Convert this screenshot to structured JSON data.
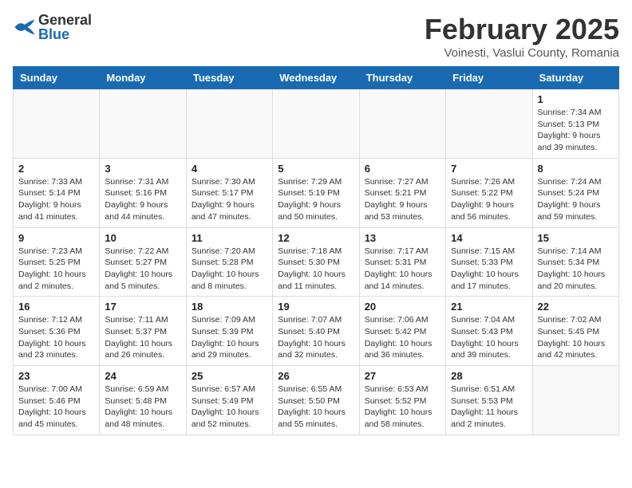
{
  "header": {
    "logo_general": "General",
    "logo_blue": "Blue",
    "month": "February 2025",
    "location": "Voinesti, Vaslui County, Romania"
  },
  "days_of_week": [
    "Sunday",
    "Monday",
    "Tuesday",
    "Wednesday",
    "Thursday",
    "Friday",
    "Saturday"
  ],
  "weeks": [
    [
      {
        "day": "",
        "info": ""
      },
      {
        "day": "",
        "info": ""
      },
      {
        "day": "",
        "info": ""
      },
      {
        "day": "",
        "info": ""
      },
      {
        "day": "",
        "info": ""
      },
      {
        "day": "",
        "info": ""
      },
      {
        "day": "1",
        "info": "Sunrise: 7:34 AM\nSunset: 5:13 PM\nDaylight: 9 hours and 39 minutes."
      }
    ],
    [
      {
        "day": "2",
        "info": "Sunrise: 7:33 AM\nSunset: 5:14 PM\nDaylight: 9 hours and 41 minutes."
      },
      {
        "day": "3",
        "info": "Sunrise: 7:31 AM\nSunset: 5:16 PM\nDaylight: 9 hours and 44 minutes."
      },
      {
        "day": "4",
        "info": "Sunrise: 7:30 AM\nSunset: 5:17 PM\nDaylight: 9 hours and 47 minutes."
      },
      {
        "day": "5",
        "info": "Sunrise: 7:29 AM\nSunset: 5:19 PM\nDaylight: 9 hours and 50 minutes."
      },
      {
        "day": "6",
        "info": "Sunrise: 7:27 AM\nSunset: 5:21 PM\nDaylight: 9 hours and 53 minutes."
      },
      {
        "day": "7",
        "info": "Sunrise: 7:26 AM\nSunset: 5:22 PM\nDaylight: 9 hours and 56 minutes."
      },
      {
        "day": "8",
        "info": "Sunrise: 7:24 AM\nSunset: 5:24 PM\nDaylight: 9 hours and 59 minutes."
      }
    ],
    [
      {
        "day": "9",
        "info": "Sunrise: 7:23 AM\nSunset: 5:25 PM\nDaylight: 10 hours and 2 minutes."
      },
      {
        "day": "10",
        "info": "Sunrise: 7:22 AM\nSunset: 5:27 PM\nDaylight: 10 hours and 5 minutes."
      },
      {
        "day": "11",
        "info": "Sunrise: 7:20 AM\nSunset: 5:28 PM\nDaylight: 10 hours and 8 minutes."
      },
      {
        "day": "12",
        "info": "Sunrise: 7:18 AM\nSunset: 5:30 PM\nDaylight: 10 hours and 11 minutes."
      },
      {
        "day": "13",
        "info": "Sunrise: 7:17 AM\nSunset: 5:31 PM\nDaylight: 10 hours and 14 minutes."
      },
      {
        "day": "14",
        "info": "Sunrise: 7:15 AM\nSunset: 5:33 PM\nDaylight: 10 hours and 17 minutes."
      },
      {
        "day": "15",
        "info": "Sunrise: 7:14 AM\nSunset: 5:34 PM\nDaylight: 10 hours and 20 minutes."
      }
    ],
    [
      {
        "day": "16",
        "info": "Sunrise: 7:12 AM\nSunset: 5:36 PM\nDaylight: 10 hours and 23 minutes."
      },
      {
        "day": "17",
        "info": "Sunrise: 7:11 AM\nSunset: 5:37 PM\nDaylight: 10 hours and 26 minutes."
      },
      {
        "day": "18",
        "info": "Sunrise: 7:09 AM\nSunset: 5:39 PM\nDaylight: 10 hours and 29 minutes."
      },
      {
        "day": "19",
        "info": "Sunrise: 7:07 AM\nSunset: 5:40 PM\nDaylight: 10 hours and 32 minutes."
      },
      {
        "day": "20",
        "info": "Sunrise: 7:06 AM\nSunset: 5:42 PM\nDaylight: 10 hours and 36 minutes."
      },
      {
        "day": "21",
        "info": "Sunrise: 7:04 AM\nSunset: 5:43 PM\nDaylight: 10 hours and 39 minutes."
      },
      {
        "day": "22",
        "info": "Sunrise: 7:02 AM\nSunset: 5:45 PM\nDaylight: 10 hours and 42 minutes."
      }
    ],
    [
      {
        "day": "23",
        "info": "Sunrise: 7:00 AM\nSunset: 5:46 PM\nDaylight: 10 hours and 45 minutes."
      },
      {
        "day": "24",
        "info": "Sunrise: 6:59 AM\nSunset: 5:48 PM\nDaylight: 10 hours and 48 minutes."
      },
      {
        "day": "25",
        "info": "Sunrise: 6:57 AM\nSunset: 5:49 PM\nDaylight: 10 hours and 52 minutes."
      },
      {
        "day": "26",
        "info": "Sunrise: 6:55 AM\nSunset: 5:50 PM\nDaylight: 10 hours and 55 minutes."
      },
      {
        "day": "27",
        "info": "Sunrise: 6:53 AM\nSunset: 5:52 PM\nDaylight: 10 hours and 58 minutes."
      },
      {
        "day": "28",
        "info": "Sunrise: 6:51 AM\nSunset: 5:53 PM\nDaylight: 11 hours and 2 minutes."
      },
      {
        "day": "",
        "info": ""
      }
    ]
  ]
}
